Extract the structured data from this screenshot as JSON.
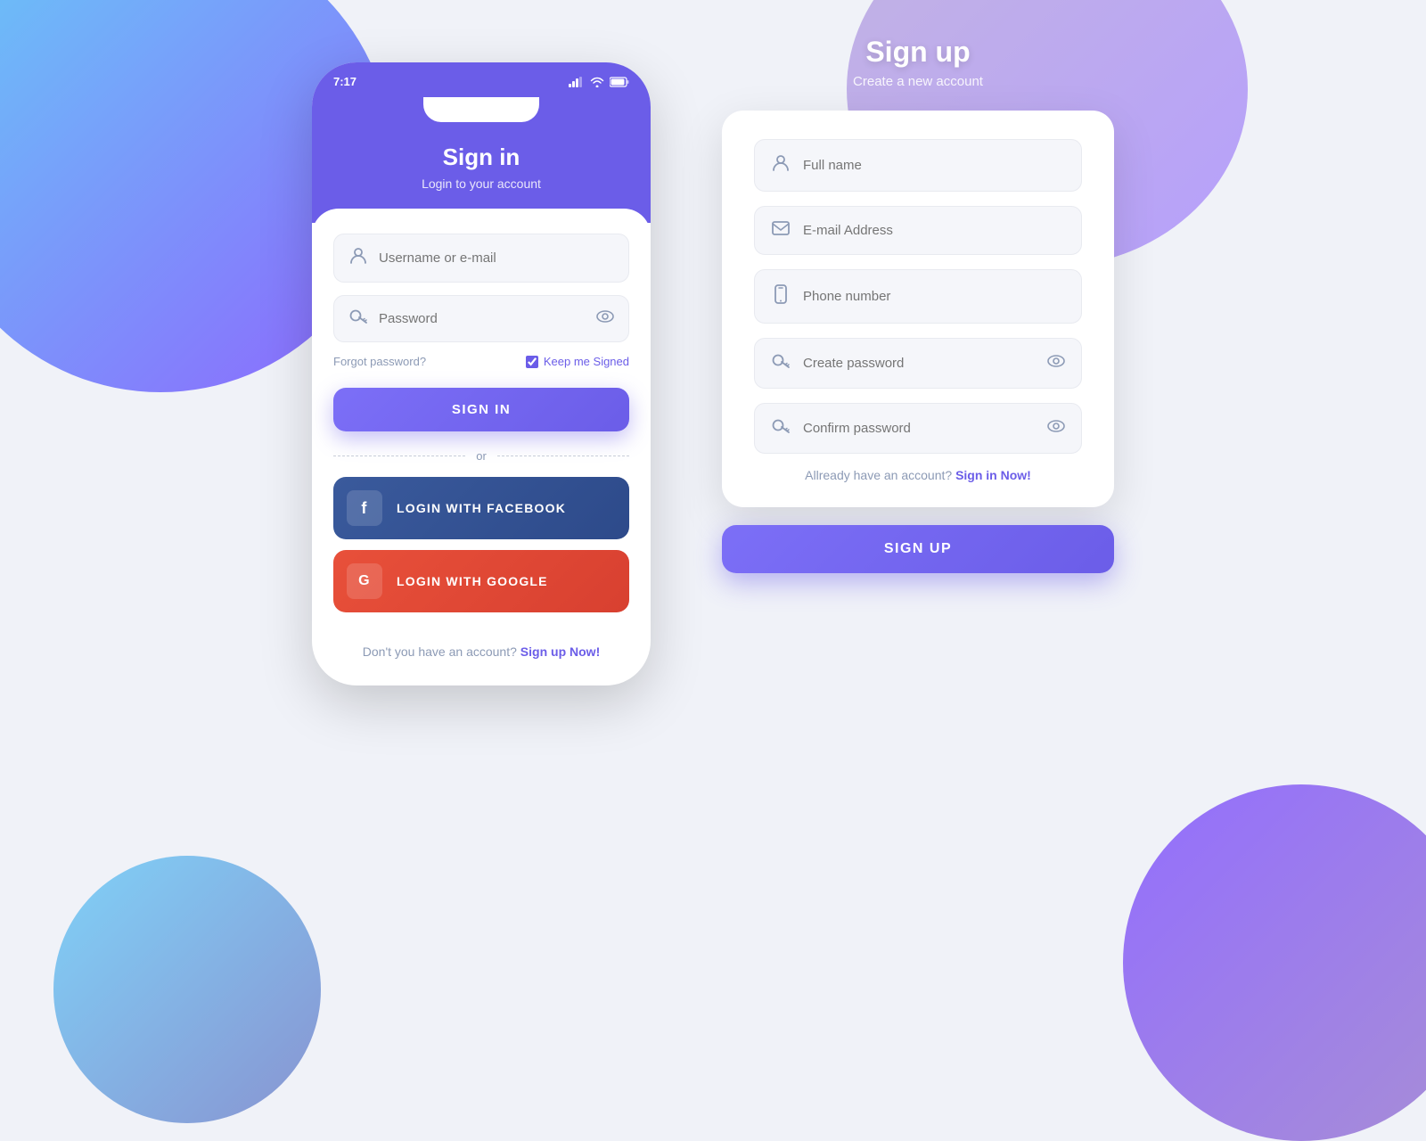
{
  "background": {
    "color": "#f0f2f8"
  },
  "phone": {
    "status_time": "7:17",
    "header_title": "Sign in",
    "header_subtitle": "Login to your account",
    "username_placeholder": "Username or e-mail",
    "password_placeholder": "Password",
    "forgot_password_label": "Forgot password?",
    "keep_signed_label": "Keep me Signed",
    "signin_button_label": "SIGN IN",
    "or_label": "or",
    "facebook_button_label": "LOGIN WITH FACEBOOK",
    "google_button_label": "LOGIN WITH GOOGLE",
    "footer_text": "Don't you have an account?",
    "footer_link": "Sign up Now!",
    "facebook_icon": "f",
    "google_icon": "G"
  },
  "signup": {
    "title": "Sign up",
    "subtitle": "Create a new account",
    "fullname_placeholder": "Full name",
    "email_placeholder": "E-mail Address",
    "phone_placeholder": "Phone number",
    "create_password_placeholder": "Create password",
    "confirm_password_placeholder": "Confirm password",
    "already_account_text": "Allready have an account?",
    "already_account_link": "Sign in Now!",
    "signup_button_label": "SIGN UP"
  }
}
